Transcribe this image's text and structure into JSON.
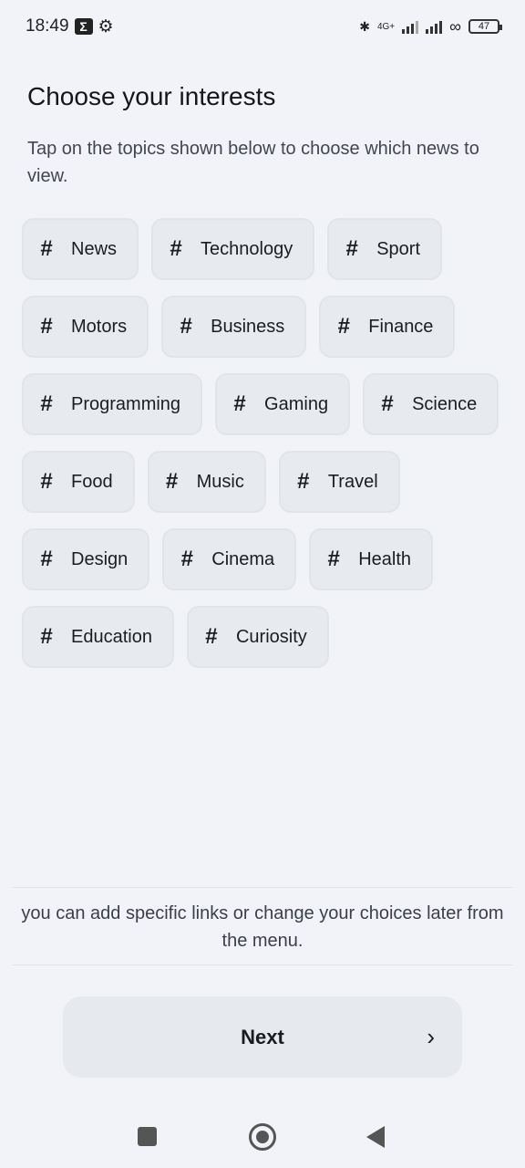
{
  "status_bar": {
    "time": "18:49",
    "network": "4G+",
    "battery": "47"
  },
  "title": "Choose your interests",
  "subtitle": "Tap on the topics shown below to choose which news to view.",
  "topics": [
    "News",
    "Technology",
    "Sport",
    "Motors",
    "Business",
    "Finance",
    "Programming",
    "Gaming",
    "Science",
    "Food",
    "Music",
    "Travel",
    "Design",
    "Cinema",
    "Health",
    "Education",
    "Curiosity"
  ],
  "hash_symbol": "#",
  "note": "you can add specific links or change your choices later from the menu.",
  "next_label": "Next",
  "next_chevron": "›"
}
